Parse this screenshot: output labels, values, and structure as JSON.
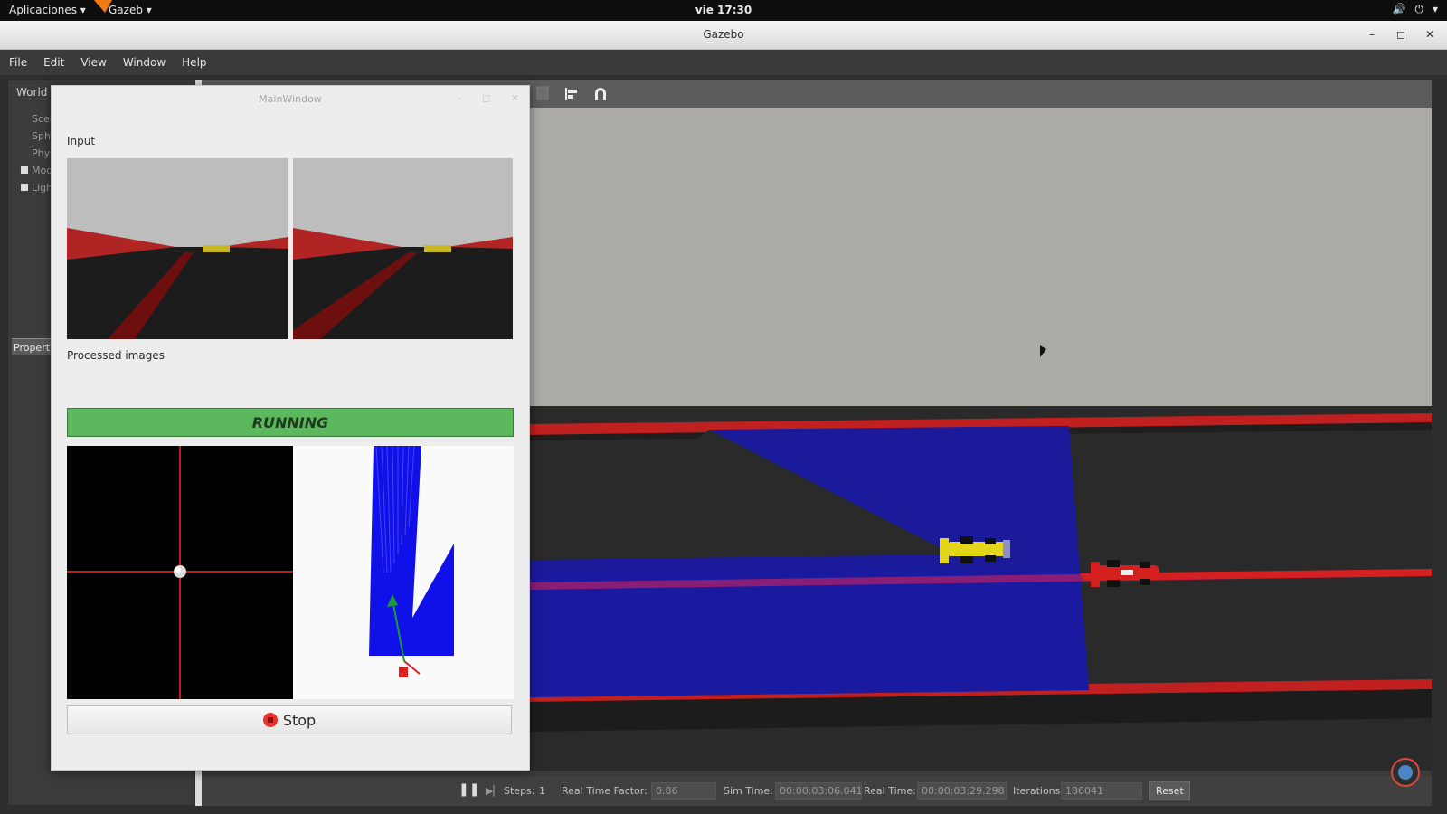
{
  "desktop": {
    "apps_menu": "Aplicaciones ▾",
    "active_app": "Gazeb ▾",
    "clock": "vie 17:30",
    "volume_icon": "volume-icon",
    "power_icon": "power-icon",
    "power_arrow": "▾"
  },
  "window": {
    "title": "Gazebo",
    "minimize": "–",
    "maximize": "◻",
    "close": "✕"
  },
  "menu": [
    "File",
    "Edit",
    "View",
    "Window",
    "Help"
  ],
  "world_panel": {
    "tab": "World",
    "items": [
      "Scen",
      "Sphe",
      "Phys",
      "Mod",
      "Ligh"
    ],
    "properties_tab": "Propert"
  },
  "toolbar_icons": [
    "copy-icon",
    "align-icon",
    "magnet-icon"
  ],
  "main_window": {
    "title": "MainWindow",
    "minimize": "–",
    "maximize": "◻",
    "close": "✕",
    "input_label": "Input",
    "processed_label": "Processed images",
    "status": "RUNNING",
    "status_color": "#5cb85c",
    "stop_label": "Stop"
  },
  "status_bar": {
    "steps_label": "Steps:",
    "steps_value": "1",
    "rtf_label": "Real Time Factor:",
    "rtf_value": "0.86",
    "sim_time_label": "Sim Time:",
    "sim_time_value": "00:00:03:06.041",
    "real_time_label": "Real Time:",
    "real_time_value": "00:00:03:29.298",
    "iterations_label": "Iterations:",
    "iterations_value": "186041",
    "reset_label": "Reset"
  }
}
